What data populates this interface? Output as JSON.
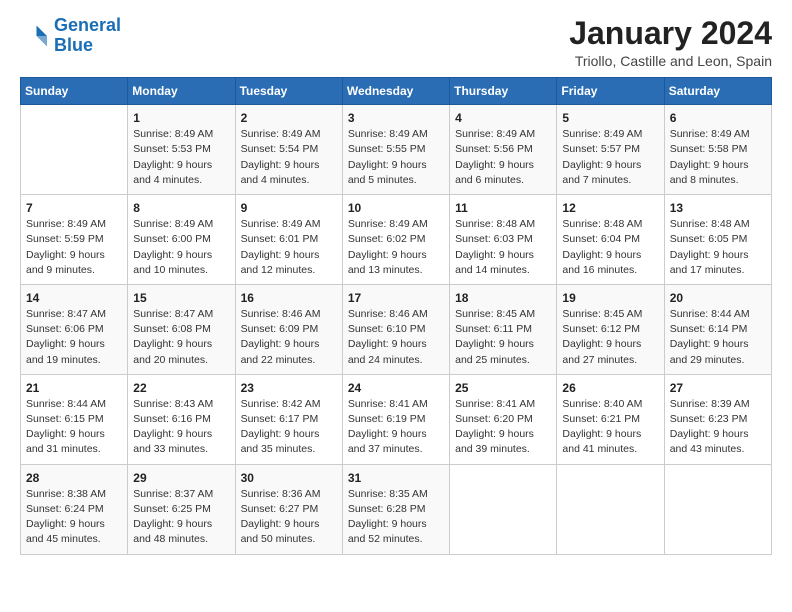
{
  "header": {
    "logo_line1": "General",
    "logo_line2": "Blue",
    "month_title": "January 2024",
    "subtitle": "Triollo, Castille and Leon, Spain"
  },
  "weekdays": [
    "Sunday",
    "Monday",
    "Tuesday",
    "Wednesday",
    "Thursday",
    "Friday",
    "Saturday"
  ],
  "weeks": [
    [
      {
        "day": "",
        "info": ""
      },
      {
        "day": "1",
        "info": "Sunrise: 8:49 AM\nSunset: 5:53 PM\nDaylight: 9 hours\nand 4 minutes."
      },
      {
        "day": "2",
        "info": "Sunrise: 8:49 AM\nSunset: 5:54 PM\nDaylight: 9 hours\nand 4 minutes."
      },
      {
        "day": "3",
        "info": "Sunrise: 8:49 AM\nSunset: 5:55 PM\nDaylight: 9 hours\nand 5 minutes."
      },
      {
        "day": "4",
        "info": "Sunrise: 8:49 AM\nSunset: 5:56 PM\nDaylight: 9 hours\nand 6 minutes."
      },
      {
        "day": "5",
        "info": "Sunrise: 8:49 AM\nSunset: 5:57 PM\nDaylight: 9 hours\nand 7 minutes."
      },
      {
        "day": "6",
        "info": "Sunrise: 8:49 AM\nSunset: 5:58 PM\nDaylight: 9 hours\nand 8 minutes."
      }
    ],
    [
      {
        "day": "7",
        "info": "Sunrise: 8:49 AM\nSunset: 5:59 PM\nDaylight: 9 hours\nand 9 minutes."
      },
      {
        "day": "8",
        "info": "Sunrise: 8:49 AM\nSunset: 6:00 PM\nDaylight: 9 hours\nand 10 minutes."
      },
      {
        "day": "9",
        "info": "Sunrise: 8:49 AM\nSunset: 6:01 PM\nDaylight: 9 hours\nand 12 minutes."
      },
      {
        "day": "10",
        "info": "Sunrise: 8:49 AM\nSunset: 6:02 PM\nDaylight: 9 hours\nand 13 minutes."
      },
      {
        "day": "11",
        "info": "Sunrise: 8:48 AM\nSunset: 6:03 PM\nDaylight: 9 hours\nand 14 minutes."
      },
      {
        "day": "12",
        "info": "Sunrise: 8:48 AM\nSunset: 6:04 PM\nDaylight: 9 hours\nand 16 minutes."
      },
      {
        "day": "13",
        "info": "Sunrise: 8:48 AM\nSunset: 6:05 PM\nDaylight: 9 hours\nand 17 minutes."
      }
    ],
    [
      {
        "day": "14",
        "info": "Sunrise: 8:47 AM\nSunset: 6:06 PM\nDaylight: 9 hours\nand 19 minutes."
      },
      {
        "day": "15",
        "info": "Sunrise: 8:47 AM\nSunset: 6:08 PM\nDaylight: 9 hours\nand 20 minutes."
      },
      {
        "day": "16",
        "info": "Sunrise: 8:46 AM\nSunset: 6:09 PM\nDaylight: 9 hours\nand 22 minutes."
      },
      {
        "day": "17",
        "info": "Sunrise: 8:46 AM\nSunset: 6:10 PM\nDaylight: 9 hours\nand 24 minutes."
      },
      {
        "day": "18",
        "info": "Sunrise: 8:45 AM\nSunset: 6:11 PM\nDaylight: 9 hours\nand 25 minutes."
      },
      {
        "day": "19",
        "info": "Sunrise: 8:45 AM\nSunset: 6:12 PM\nDaylight: 9 hours\nand 27 minutes."
      },
      {
        "day": "20",
        "info": "Sunrise: 8:44 AM\nSunset: 6:14 PM\nDaylight: 9 hours\nand 29 minutes."
      }
    ],
    [
      {
        "day": "21",
        "info": "Sunrise: 8:44 AM\nSunset: 6:15 PM\nDaylight: 9 hours\nand 31 minutes."
      },
      {
        "day": "22",
        "info": "Sunrise: 8:43 AM\nSunset: 6:16 PM\nDaylight: 9 hours\nand 33 minutes."
      },
      {
        "day": "23",
        "info": "Sunrise: 8:42 AM\nSunset: 6:17 PM\nDaylight: 9 hours\nand 35 minutes."
      },
      {
        "day": "24",
        "info": "Sunrise: 8:41 AM\nSunset: 6:19 PM\nDaylight: 9 hours\nand 37 minutes."
      },
      {
        "day": "25",
        "info": "Sunrise: 8:41 AM\nSunset: 6:20 PM\nDaylight: 9 hours\nand 39 minutes."
      },
      {
        "day": "26",
        "info": "Sunrise: 8:40 AM\nSunset: 6:21 PM\nDaylight: 9 hours\nand 41 minutes."
      },
      {
        "day": "27",
        "info": "Sunrise: 8:39 AM\nSunset: 6:23 PM\nDaylight: 9 hours\nand 43 minutes."
      }
    ],
    [
      {
        "day": "28",
        "info": "Sunrise: 8:38 AM\nSunset: 6:24 PM\nDaylight: 9 hours\nand 45 minutes."
      },
      {
        "day": "29",
        "info": "Sunrise: 8:37 AM\nSunset: 6:25 PM\nDaylight: 9 hours\nand 48 minutes."
      },
      {
        "day": "30",
        "info": "Sunrise: 8:36 AM\nSunset: 6:27 PM\nDaylight: 9 hours\nand 50 minutes."
      },
      {
        "day": "31",
        "info": "Sunrise: 8:35 AM\nSunset: 6:28 PM\nDaylight: 9 hours\nand 52 minutes."
      },
      {
        "day": "",
        "info": ""
      },
      {
        "day": "",
        "info": ""
      },
      {
        "day": "",
        "info": ""
      }
    ]
  ]
}
